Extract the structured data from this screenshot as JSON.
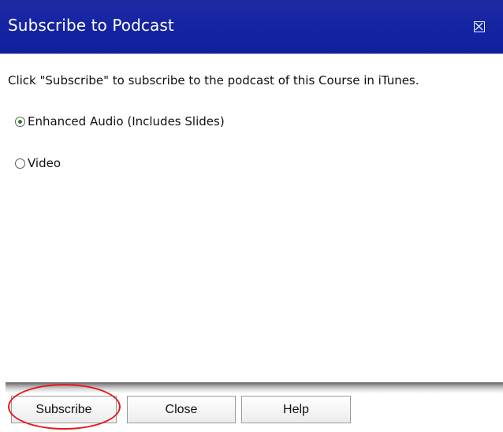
{
  "dialog": {
    "title": "Subscribe to Podcast",
    "close_icon": "close-box-icon"
  },
  "content": {
    "instruction": "Click \"Subscribe\" to subscribe to the podcast of this Course in iTunes.",
    "options": [
      {
        "label": "Enhanced Audio (Includes Slides)",
        "selected": true
      },
      {
        "label": "Video",
        "selected": false
      }
    ]
  },
  "footer": {
    "subscribe_label": "Subscribe",
    "close_label": "Close",
    "help_label": "Help"
  },
  "colors": {
    "titlebar": "#1423a3",
    "title_text": "#ffffff",
    "highlight": "#e8171b",
    "radio_dot": "#2f7a2f"
  }
}
